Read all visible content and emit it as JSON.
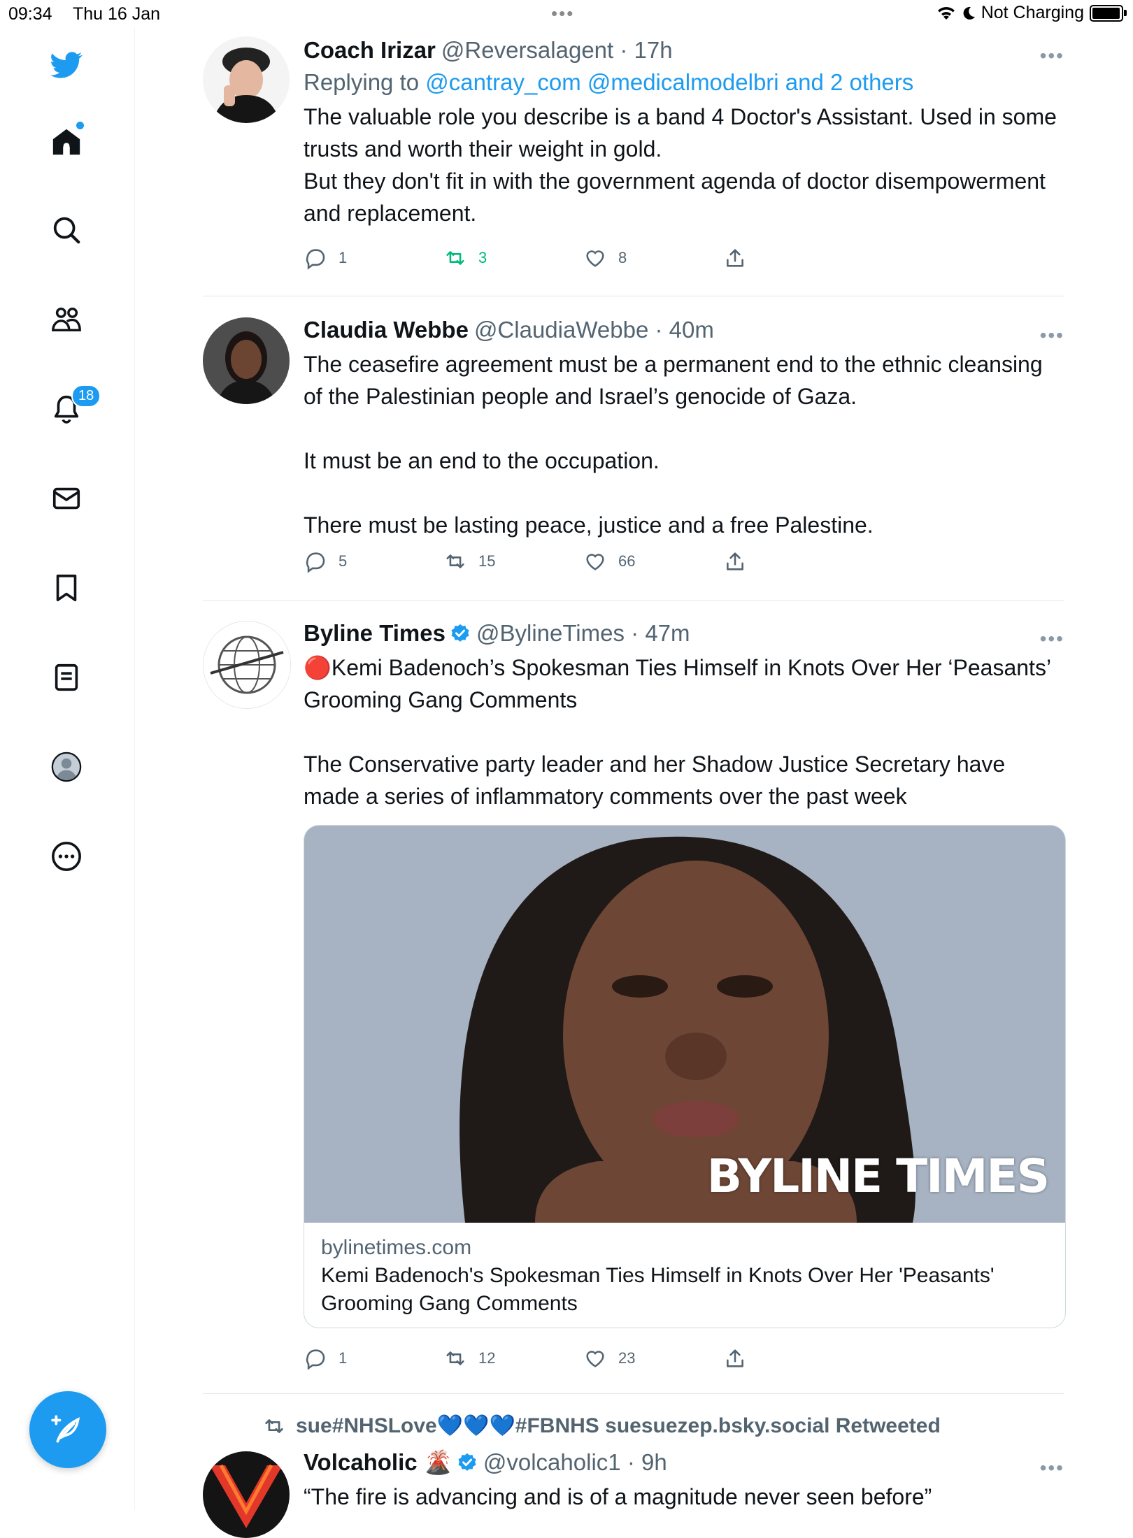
{
  "status_bar": {
    "time": "09:34",
    "date": "Thu 16 Jan",
    "battery_text": "Not Charging",
    "battery_level": 0.88
  },
  "nav": {
    "items": [
      "twitter-logo-icon",
      "home-icon",
      "search-icon",
      "communities-icon",
      "notifications-icon",
      "messages-icon",
      "bookmarks-icon",
      "lists-icon",
      "profile-icon",
      "more-icon"
    ],
    "notification_count": "18",
    "accent": "#1d9bf0"
  },
  "tweets": [
    {
      "name": "Coach Irizar",
      "handle": "@Reversalagent",
      "time": "· 17h",
      "replying_prefix": "Replying to",
      "replying_to": "@cantray_com @medicalmodelbri and 2 others",
      "text": "The valuable role you describe is a band 4 Doctor's Assistant. Used in some trusts and worth their weight in gold.\nBut they don't fit in with the government agenda of doctor disempowerment and replacement.",
      "replies": "1",
      "retweets": "3",
      "likes": "8"
    },
    {
      "name": "Claudia Webbe",
      "handle": "@ClaudiaWebbe",
      "time": "· 40m",
      "text": "The ceasefire agreement must be a permanent end to the ethnic cleansing of the Palestinian people and Israel’s genocide of Gaza.\n\nIt must be an end to the occupation.\n\nThere must be lasting peace, justice and a free Palestine.",
      "replies": "5",
      "retweets": "15",
      "likes": "66"
    },
    {
      "name": "Byline Times",
      "handle": "@BylineTimes",
      "time": "· 47m",
      "text": "🔴Kemi Badenoch’s Spokesman Ties Himself in Knots Over Her ‘Peasants’ Grooming Gang Comments\n\nThe Conservative party leader and her Shadow Justice Secretary have made a series of inflammatory comments over the past week",
      "card": {
        "watermark": "BYLINE TIMES",
        "domain": "bylinetimes.com",
        "title": "Kemi Badenoch's Spokesman Ties Himself in Knots Over Her 'Peasants' Grooming Gang Comments"
      },
      "replies": "1",
      "retweets": "12",
      "likes": "23"
    },
    {
      "retweeted_by": "sue#NHSLove💙💙💙#FBNHS suesuezep.bsky.social Retweeted",
      "name": "Volcaholic",
      "name_emoji": "🌋",
      "handle": "@volcaholic1",
      "time": "· 9h",
      "text": "“The fire is advancing and is of a magnitude never seen before”"
    }
  ]
}
